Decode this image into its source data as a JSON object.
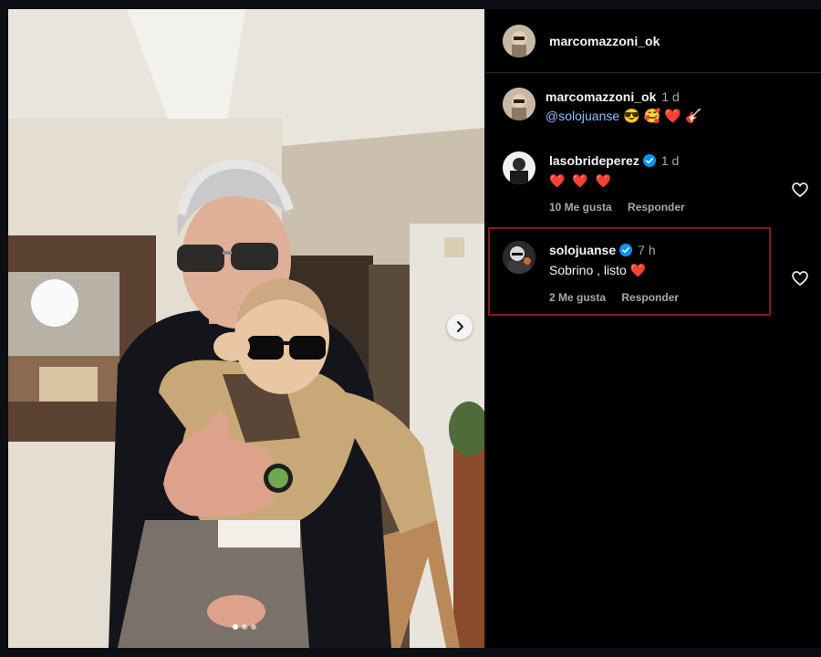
{
  "post": {
    "author": "marcomazzoni_ok",
    "carousel": {
      "slides": 3,
      "active_index": 0
    }
  },
  "caption": {
    "username": "marcomazzoni_ok",
    "time": "1 d",
    "mention": "@solojuanse",
    "emojis": [
      "😎",
      "🥰",
      "❤️",
      "🎸"
    ]
  },
  "comments": [
    {
      "username": "lasobrideperez",
      "verified": true,
      "time": "1 d",
      "text": "❤️ ❤️ ❤️",
      "likes": "10 Me gusta",
      "reply": "Responder"
    },
    {
      "username": "solojuanse",
      "verified": true,
      "time": "7 h",
      "text": "Sobrino , listo ❤️",
      "likes": "2 Me gusta",
      "reply": "Responder",
      "highlighted": true
    }
  ],
  "colors": {
    "panel_bg": "#000000",
    "verified_blue": "#0095f6",
    "highlight_border": "#8a1620",
    "heart_red": "#ff3040"
  },
  "icons": {
    "next": "chevron-right-icon",
    "like": "heart-outline-icon",
    "verified": "verified-badge-icon"
  }
}
